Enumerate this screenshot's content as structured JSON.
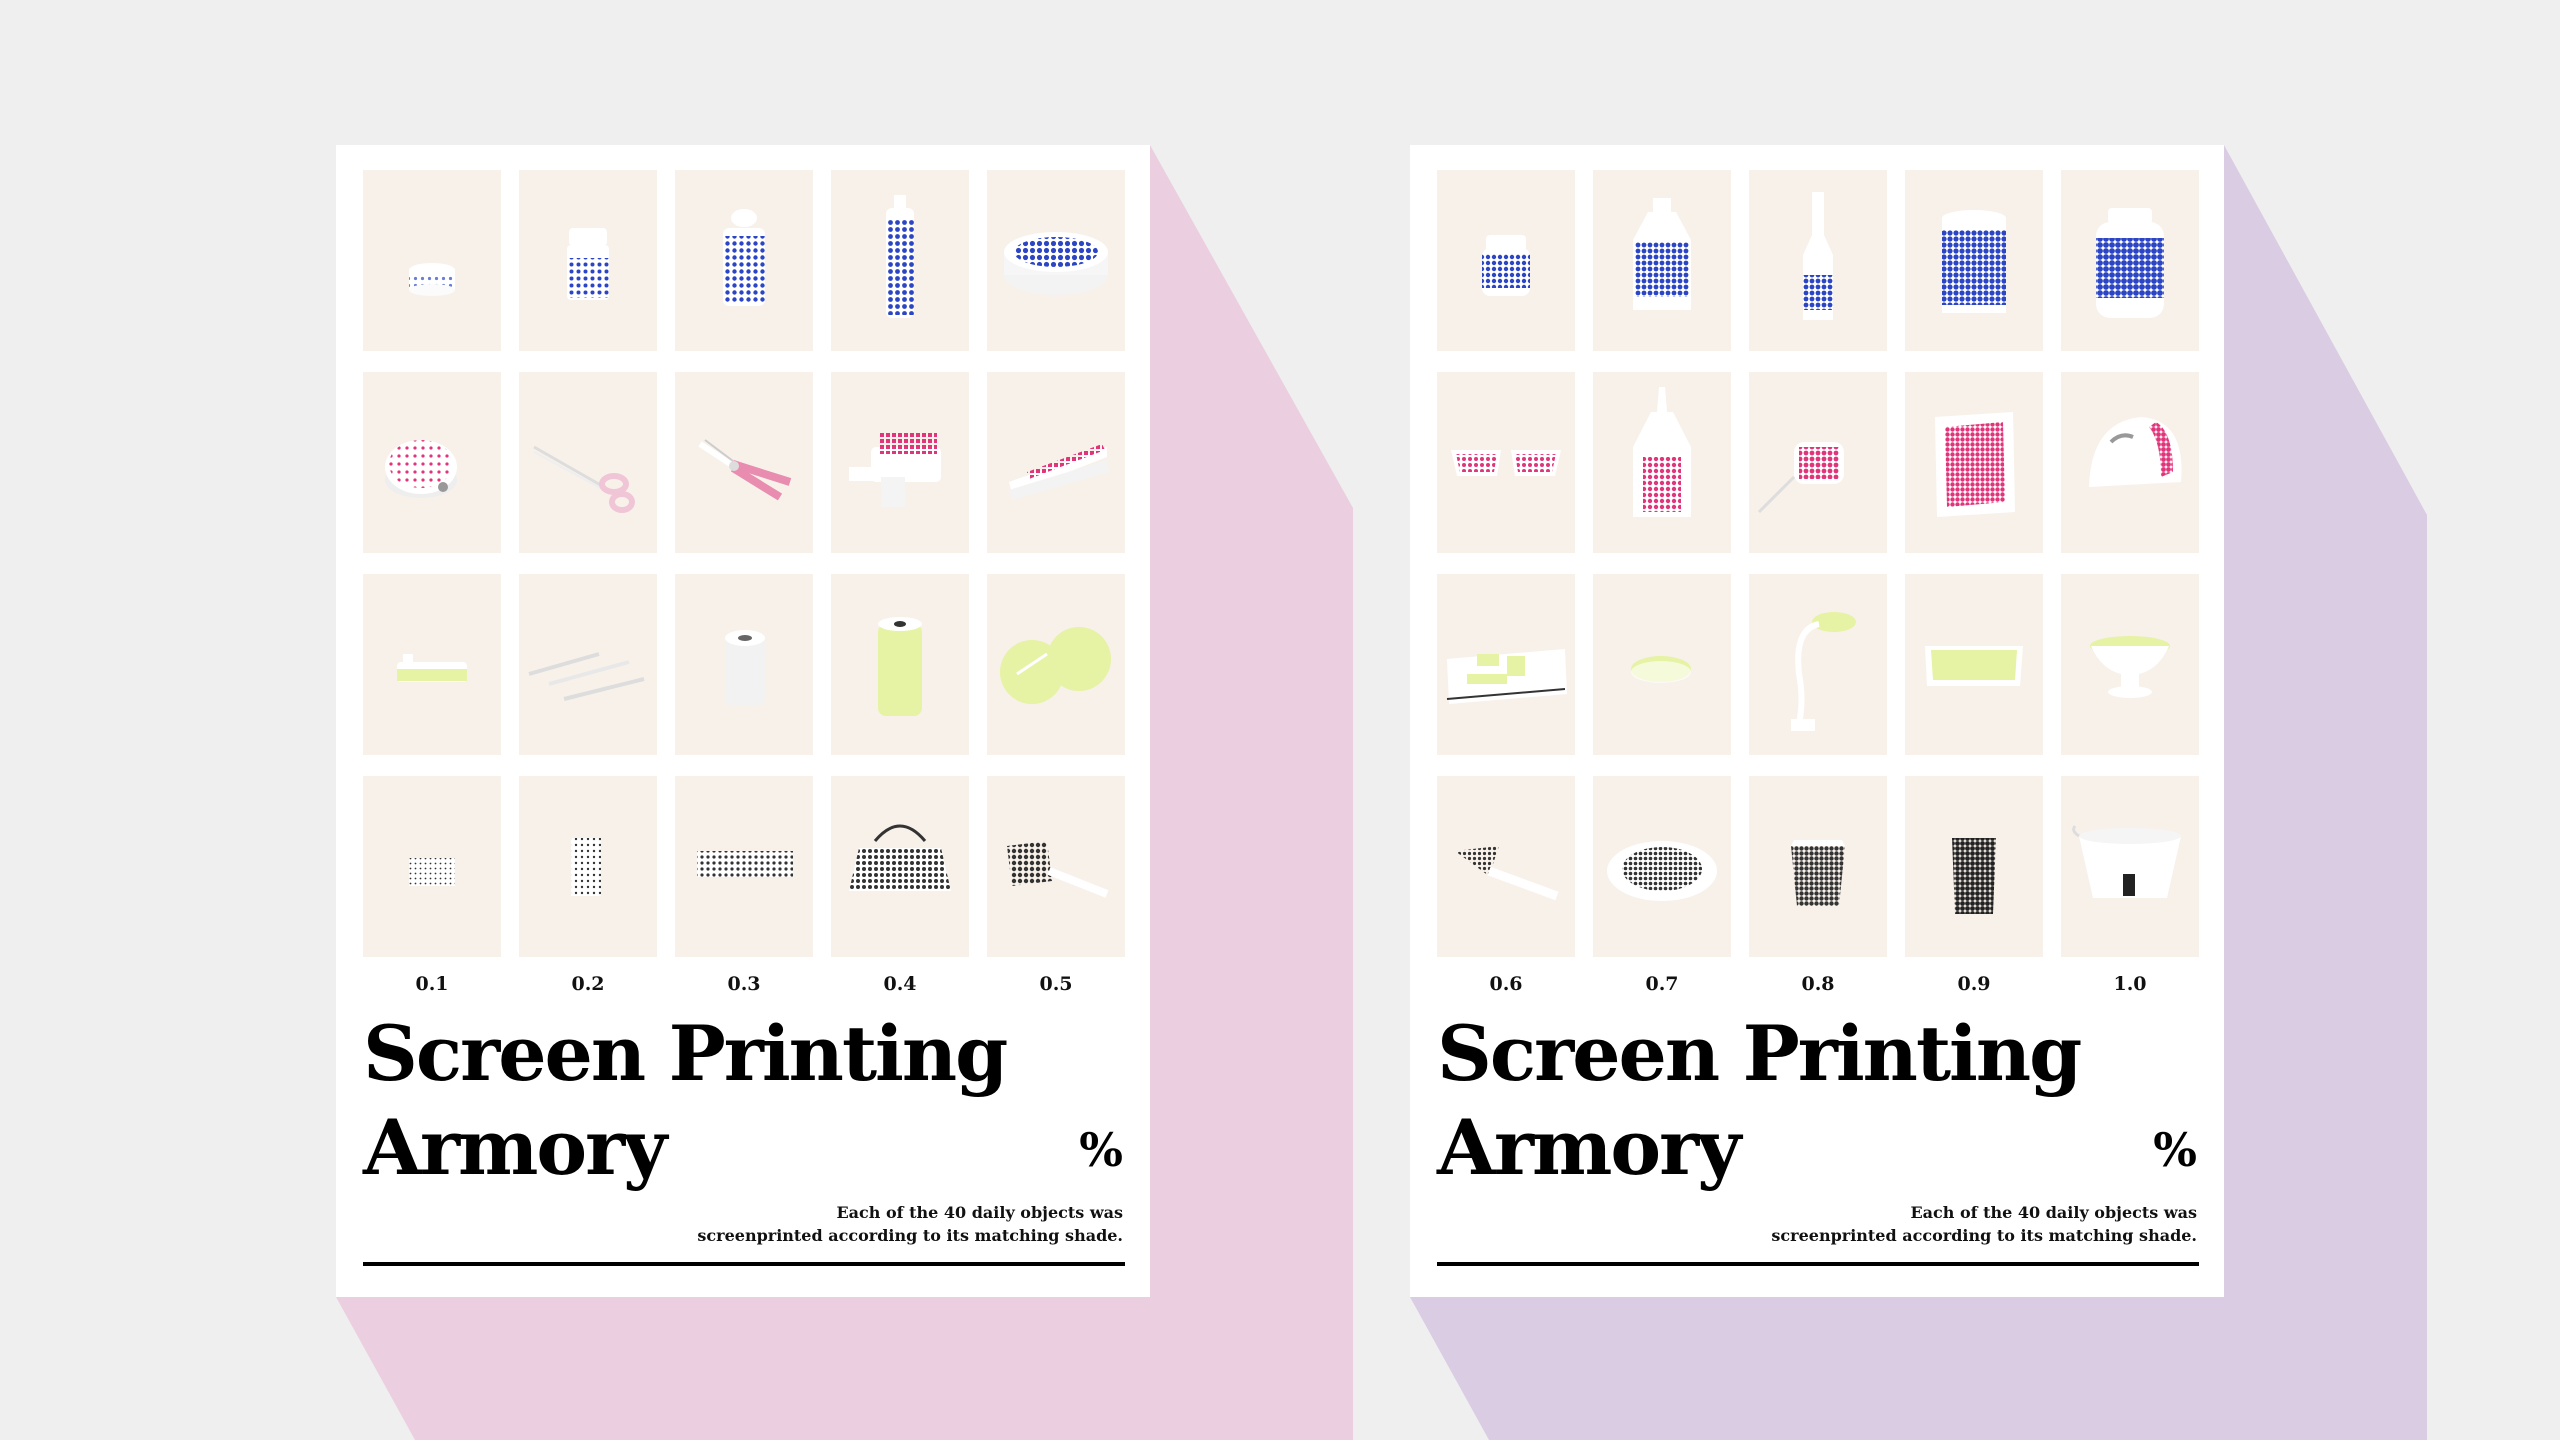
{
  "colors": {
    "background": "#efefef",
    "shadow_left": "#ebcfe0",
    "shadow_right": "#dacce2",
    "poster": "#ffffff",
    "blue": "#2b45c4",
    "pink": "#e0357a",
    "yellow": "#e6f2a4",
    "black": "#1e1e1e"
  },
  "posters": [
    {
      "title_line1": "Screen Printing",
      "title_line2": "Armory",
      "percent_sign": "%",
      "caption_line1": "Each of the 40 daily objects was",
      "caption_line2": "screenprinted according to its matching shade.",
      "column_labels": [
        "0.1",
        "0.2",
        "0.3",
        "0.4",
        "0.5"
      ],
      "objects": [
        [
          "small-jar-icon",
          "pill-bottle-icon",
          "tall-bottle-icon",
          "spray-bottle-icon",
          "round-tin-icon"
        ],
        [
          "tape-measure-icon",
          "scissors-icon",
          "pliers-icon",
          "glue-gun-icon",
          "stapler-icon"
        ],
        [
          "usb-stick-icon",
          "hair-clips-icon",
          "tape-roll-icon",
          "soda-can-icon",
          "coasters-icon"
        ],
        [
          "card-holder-icon",
          "phone-case-icon",
          "pencil-case-icon",
          "handbag-icon",
          "spatula-icon"
        ]
      ]
    },
    {
      "title_line1": "Screen Printing",
      "title_line2": "Armory",
      "percent_sign": "%",
      "caption_line1": "Each of the 40 daily objects was",
      "caption_line2": "screenprinted according to its matching shade.",
      "column_labels": [
        "0.6",
        "0.7",
        "0.8",
        "0.9",
        "1.0"
      ],
      "objects": [
        [
          "jar-icon",
          "milk-bottle-icon",
          "beer-bottle-icon",
          "canister-icon",
          "large-jar-icon"
        ],
        [
          "sunglasses-icon",
          "glue-bottle-icon",
          "tape-measure-icon",
          "photo-frame-icon",
          "helmet-icon"
        ],
        [
          "keyboard-icon",
          "computer-mouse-icon",
          "desk-lamp-icon",
          "tablet-icon",
          "cake-stand-icon"
        ],
        [
          "cake-server-icon",
          "plate-icon",
          "planter-icon",
          "waste-bin-icon",
          "bucket-icon"
        ]
      ]
    }
  ]
}
